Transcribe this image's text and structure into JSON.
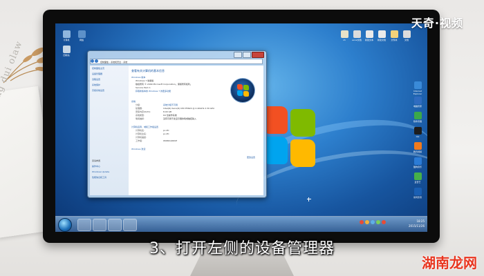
{
  "brand": "天奇·视频",
  "caption": "3、打开左侧的设备管理器",
  "watermark": "湖南龙网",
  "notebook_text": "Eeling dui olaw",
  "window": {
    "address": "控制面板 › 系统和安全 › 系统",
    "title": "查看有关计算机的基本信息",
    "sidebar_items": [
      "控制面板主页",
      "设备管理器",
      "远程设置",
      "系统保护",
      "高级系统设置"
    ],
    "see_also_title": "另请参阅",
    "see_also": [
      "操作中心",
      "Windows Update",
      "性能信息和工具"
    ],
    "edition_title": "Windows 版本",
    "edition_lines": [
      "Windows 7 旗舰版",
      "版权所有 © 2009 Microsoft Corporation。保留所有权利。",
      "Service Pack 1",
      "获取新版本的 Windows 7 的更多功能"
    ],
    "system_title": "系统",
    "system_rows": [
      {
        "k": "分级:",
        "v": "系统分级不可用"
      },
      {
        "k": "处理器:",
        "v": "Intel(R) Xeon(R) CPU  E5620 @ 2.40GHz  2.39 GHz"
      },
      {
        "k": "安装内存(RAM):",
        "v": "8.00 GB"
      },
      {
        "k": "系统类型:",
        "v": "64 位操作系统"
      },
      {
        "k": "笔和触摸:",
        "v": "没有可用于此显示器的笔或触控输入"
      }
    ],
    "computer_title": "计算机名称、域和工作组设置",
    "computer_rows": [
      {
        "k": "计算机名:",
        "v": "pc-PC"
      },
      {
        "k": "计算机全名:",
        "v": "pc-PC"
      },
      {
        "k": "计算机描述:",
        "v": ""
      },
      {
        "k": "工作组:",
        "v": "WORKGROUP"
      }
    ],
    "change_link": "更改设置",
    "activation_title": "Windows 激活"
  },
  "taskbar": {
    "time": "18:25",
    "date": "2015/11/26"
  },
  "desktop_icons_left": [
    "计算机",
    "网络",
    "回收站"
  ],
  "desktop_icons_top": [
    "zh",
    "excel文档",
    "新建文本",
    "新建文档",
    "文件夹",
    "文档"
  ],
  "desktop_icons_right": [
    "Internet Explorer",
    "电脑管家",
    "软件管理",
    "QQ",
    "腾讯视频",
    "酷狗音乐",
    "爱奇艺",
    "暴风影音"
  ]
}
